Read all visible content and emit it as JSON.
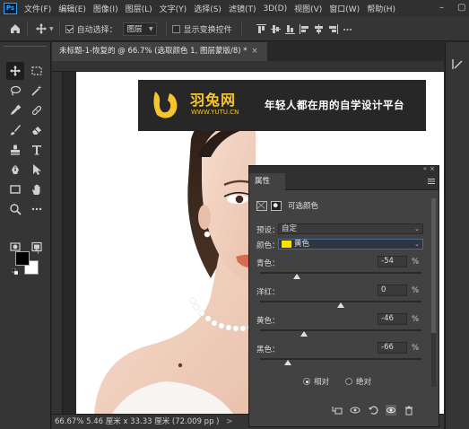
{
  "menubar": {
    "logo_text": "Ps",
    "items": [
      "文件(F)",
      "编辑(E)",
      "图像(I)",
      "图层(L)",
      "文字(Y)",
      "选择(S)",
      "滤镜(T)",
      "3D(D)",
      "视图(V)",
      "窗口(W)",
      "帮助(H)"
    ]
  },
  "options": {
    "auto_select_label": "自动选择：",
    "auto_select_value": "图层",
    "show_transform_label": "显示变换控件"
  },
  "document": {
    "tab_title": "未标题-1-恢复的 @ 66.7% (选取颜色 1, 图层蒙版/8) *",
    "tab_close": "×"
  },
  "banner": {
    "brand": "羽兔网",
    "url": "WWW.YUTU.CN",
    "slogan": "年轻人都在用的自学设计平台",
    "accent_color": "#f6c42c"
  },
  "statusbar": {
    "zoom": "66.67%",
    "doc_info": "5.46 厘米 x 33.33 厘米 (72.009 pp )",
    "arrow": ">"
  },
  "properties": {
    "title": "属性",
    "adjustment_name": "可选颜色",
    "preset_label": "预设：",
    "preset_value": "自定",
    "colors_label": "颜色：",
    "colors_value": "黄色",
    "colors_swatch": "#ffe100",
    "sliders": [
      {
        "label": "青色：",
        "value": "-54",
        "unit": "%",
        "fraction": 0.23
      },
      {
        "label": "洋红：",
        "value": "0",
        "unit": "%",
        "fraction": 0.5
      },
      {
        "label": "黄色：",
        "value": "-46",
        "unit": "%",
        "fraction": 0.27
      },
      {
        "label": "黑色：",
        "value": "-66",
        "unit": "%",
        "fraction": 0.17
      }
    ],
    "method_relative": "相对",
    "method_absolute": "绝对",
    "method_selected": "relative"
  },
  "icons": {
    "toolbar": [
      "move-icon",
      "marquee-icon",
      "lasso-icon",
      "magic-wand-icon",
      "eyedropper-icon",
      "spot-healing-icon",
      "brush-icon",
      "clone-stamp-icon",
      "history-brush-icon",
      "eraser-icon",
      "gradient-icon",
      "blur-icon",
      "dodge-icon",
      "pen-icon",
      "type-icon",
      "path-select-icon",
      "rectangle-icon",
      "hand-icon",
      "zoom-icon",
      "more-tools-icon",
      "quick-mask-icon",
      "screen-mode-icon"
    ],
    "props_bottom": [
      "clip-to-layer-icon",
      "view-previous-icon",
      "reset-icon",
      "visibility-icon",
      "delete-icon"
    ]
  }
}
